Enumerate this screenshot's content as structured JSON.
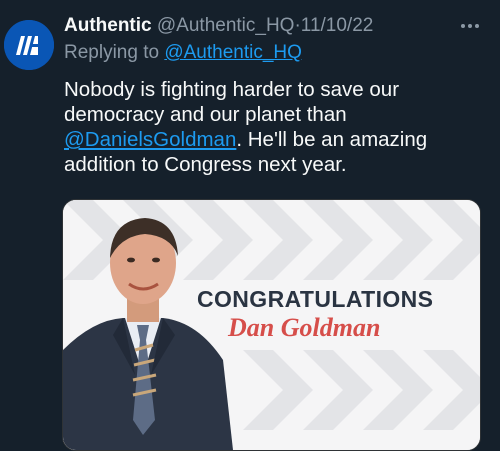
{
  "tweet": {
    "author": {
      "name": "Authentic",
      "handle": "@Authentic_HQ",
      "avatar_icon": "authentic-logo-icon",
      "avatar_color": "#0a56b5"
    },
    "separator": "·",
    "date": "11/10/22",
    "more_icon": "more-horizontal-icon",
    "reply": {
      "prefix": "Replying to ",
      "handle": "@Authentic_HQ"
    },
    "body": {
      "text_before": "Nobody is fighting harder to save our democracy and our planet than ",
      "mention": "@DanielsGoldman",
      "text_after": ". He'll be an amazing addition to Congress next year."
    },
    "media": {
      "heading": "CONGRATULATIONS",
      "name": "Dan Goldman",
      "heading_color": "#2a3442",
      "name_color": "#d64e4a"
    }
  },
  "colors": {
    "background": "#15202b",
    "text": "#f7f9f9",
    "secondary": "#8b98a5",
    "link": "#1d9bf0"
  }
}
